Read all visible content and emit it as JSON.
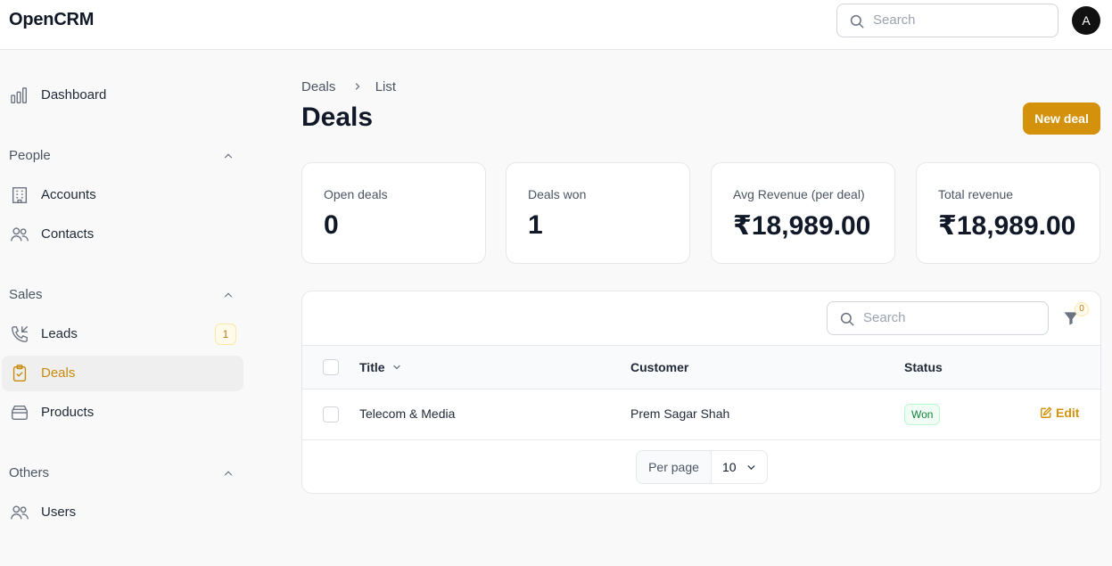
{
  "app": {
    "title": "OpenCRM"
  },
  "topbar": {
    "search_placeholder": "Search",
    "avatar_initial": "A"
  },
  "sidebar": {
    "dashboard": "Dashboard",
    "groups": {
      "people": "People",
      "sales": "Sales",
      "others": "Others"
    },
    "items": {
      "accounts": "Accounts",
      "contacts": "Contacts",
      "leads": "Leads",
      "leads_badge": "1",
      "deals": "Deals",
      "products": "Products",
      "users": "Users"
    }
  },
  "breadcrumb": {
    "parent": "Deals",
    "current": "List"
  },
  "page": {
    "title": "Deals",
    "new_button": "New deal"
  },
  "stats": [
    {
      "label": "Open deals",
      "value": "0"
    },
    {
      "label": "Deals won",
      "value": "1"
    },
    {
      "label": "Avg Revenue (per deal)",
      "value": "₹18,989.00"
    },
    {
      "label": "Total revenue",
      "value": "₹18,989.00"
    }
  ],
  "table": {
    "search_placeholder": "Search",
    "filter_count": "0",
    "columns": {
      "title": "Title",
      "customer": "Customer",
      "status": "Status"
    },
    "rows": [
      {
        "title": "Telecom & Media",
        "customer": "Prem Sagar Shah",
        "status": "Won",
        "action": "Edit"
      }
    ],
    "pagination": {
      "per_page_label": "Per page",
      "per_page_value": "10"
    }
  },
  "colors": {
    "accent": "#d4920c",
    "success": "#15803d"
  }
}
